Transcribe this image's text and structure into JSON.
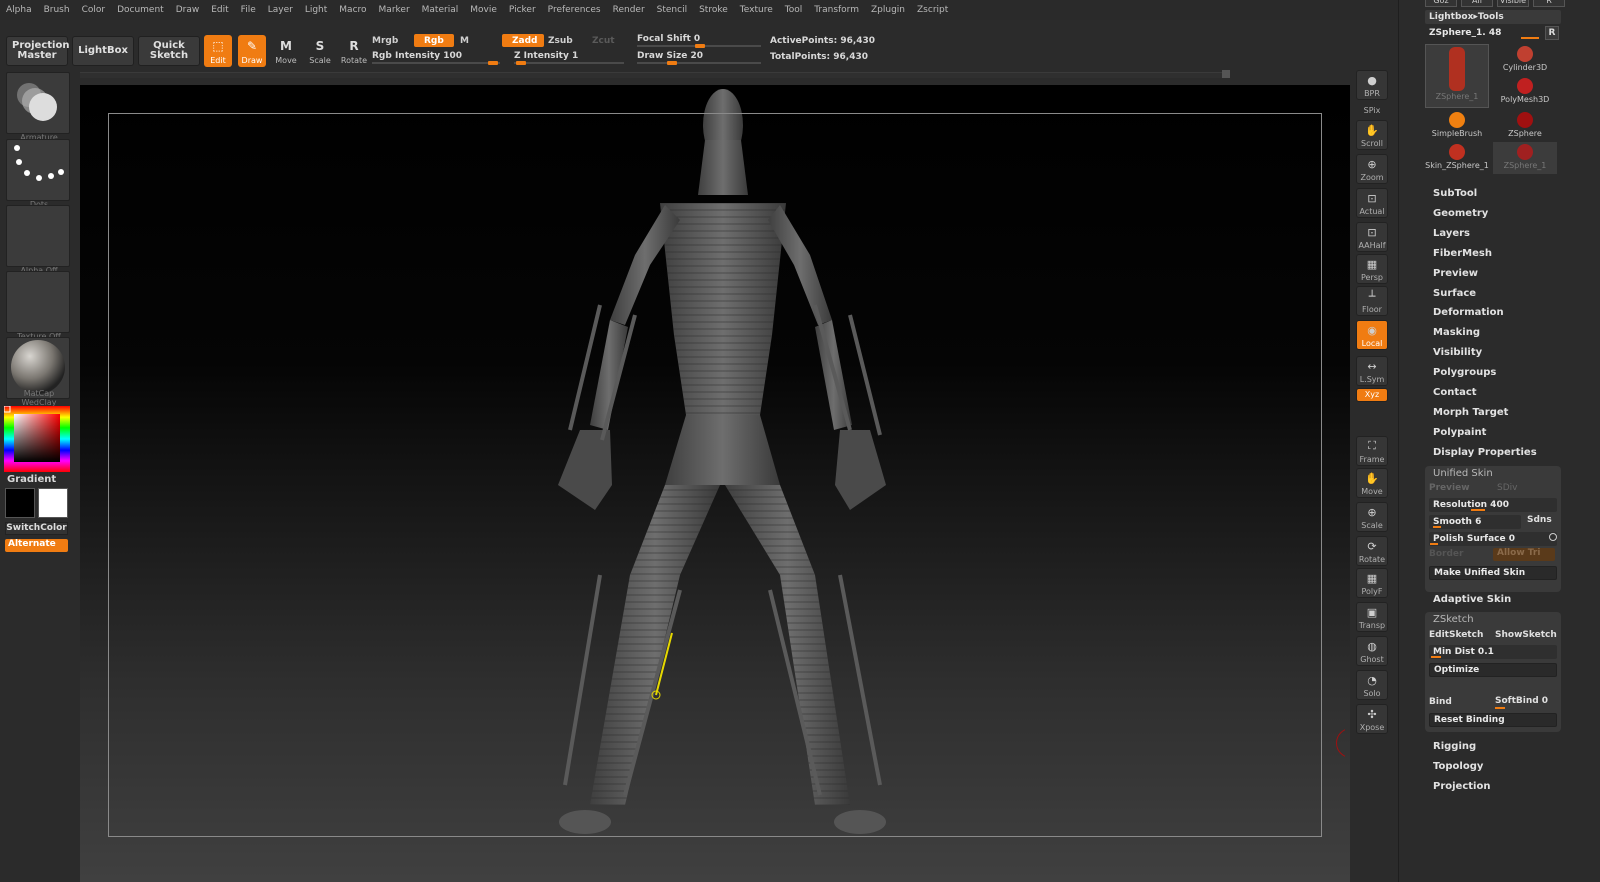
{
  "menubar": [
    "Alpha",
    "Brush",
    "Color",
    "Document",
    "Draw",
    "Edit",
    "File",
    "Layer",
    "Light",
    "Macro",
    "Marker",
    "Material",
    "Movie",
    "Picker",
    "Preferences",
    "Render",
    "Stencil",
    "Stroke",
    "Texture",
    "Tool",
    "Transform",
    "Zplugin",
    "Zscript"
  ],
  "toolbar": {
    "projection_master": "Projection Master",
    "lightbox": "LightBox",
    "quick_sketch": "Quick Sketch",
    "tools": [
      {
        "label": "Edit",
        "glyph": "⬚",
        "on": true
      },
      {
        "label": "Draw",
        "glyph": "✎",
        "on": true
      },
      {
        "label": "Move",
        "glyph": "M",
        "on": false
      },
      {
        "label": "Scale",
        "glyph": "S",
        "on": false
      },
      {
        "label": "Rotate",
        "glyph": "R",
        "on": false
      }
    ],
    "mrgb": "Mrgb",
    "rgb": "Rgb",
    "m": "M",
    "zadd": "Zadd",
    "zsub": "Zsub",
    "zcut": "Zcut",
    "rgb_intensity": "Rgb Intensity 100",
    "z_intensity": "Z Intensity 1",
    "focal_shift": "Focal Shift 0",
    "draw_size": "Draw Size 20",
    "active_points": "ActivePoints: 96,430",
    "total_points": "TotalPoints: 96,430"
  },
  "leftshelf": {
    "brush_caption": "Armature",
    "stroke_caption": "Dots",
    "alpha_caption": "Alpha Off",
    "texture_caption": "Texture Off",
    "material_caption": "MatCap WedClay",
    "gradient": "Gradient",
    "switchcolor": "SwitchColor",
    "alternate": "Alternate"
  },
  "rightshelf": [
    {
      "label": "BPR",
      "glyph": "●",
      "on": false
    },
    {
      "label": "SPix",
      "glyph": "",
      "on": false
    },
    {
      "label": "Scroll",
      "glyph": "✋",
      "on": false
    },
    {
      "label": "Zoom",
      "glyph": "⊕",
      "on": false
    },
    {
      "label": "Actual",
      "glyph": "⊡",
      "on": false
    },
    {
      "label": "AAHalf",
      "glyph": "⊡",
      "on": false
    },
    {
      "label": "Persp",
      "glyph": "▦",
      "on": false
    },
    {
      "label": "Floor",
      "glyph": "┴",
      "on": false
    },
    {
      "label": "Local",
      "glyph": "◉",
      "on": true
    },
    {
      "label": "L.Sym",
      "glyph": "↔",
      "on": false
    },
    {
      "label": "Xyz",
      "glyph": "",
      "on": true
    },
    {
      "label": "Frame",
      "glyph": "⛶",
      "on": false
    },
    {
      "label": "Move",
      "glyph": "✋",
      "on": false
    },
    {
      "label": "Scale",
      "glyph": "⊕",
      "on": false
    },
    {
      "label": "Rotate",
      "glyph": "⟳",
      "on": false
    },
    {
      "label": "PolyF",
      "glyph": "▦",
      "on": false
    },
    {
      "label": "Transp",
      "glyph": "▣",
      "on": false
    },
    {
      "label": "Ghost",
      "glyph": "◍",
      "on": false
    },
    {
      "label": "Solo",
      "glyph": "◔",
      "on": false
    },
    {
      "label": "Xpose",
      "glyph": "✣",
      "on": false
    }
  ],
  "palette": {
    "top_buttons": [
      "Goz",
      "All",
      "Visible",
      "R"
    ],
    "header": "Lightbox▸Tools",
    "current_tool": "ZSphere_1. 48",
    "r_button": "R",
    "thumbs": [
      "ZSphere_1",
      "Cylinder3D",
      "PolyMesh3D",
      "SimpleBrush",
      "ZSphere",
      "Skin_ZSphere_1",
      "ZSphere_1"
    ],
    "menu_top": [
      "SubTool",
      "Geometry",
      "Layers",
      "FiberMesh",
      "Preview",
      "Surface",
      "Deformation",
      "Masking",
      "Visibility",
      "Polygroups",
      "Contact",
      "Morph Target",
      "Polypaint",
      "Display Properties"
    ],
    "unified_skin": {
      "title": "Unified Skin",
      "preview": "Preview",
      "sdiv": "SDiv",
      "resolution": "Resolution 400",
      "smooth": "Smooth 6",
      "sdns": "Sdns",
      "polish": "Polish Surface 0",
      "border": "Border",
      "allow_tri": "Allow Tri",
      "make": "Make Unified Skin"
    },
    "adaptive_skin": "Adaptive Skin",
    "zsketch": {
      "title": "ZSketch",
      "edit": "EditSketch",
      "show": "ShowSketch",
      "min_dist": "Min Dist 0.1",
      "optimize": "Optimize",
      "bind": "Bind",
      "softbind": "SoftBind 0",
      "reset": "Reset Binding"
    },
    "menu_bottom": [
      "Rigging",
      "Topology",
      "Projection"
    ]
  },
  "colors": {
    "accent": "#f07c12",
    "bg": "#2b2b2b",
    "canvas_top": "#000000"
  }
}
